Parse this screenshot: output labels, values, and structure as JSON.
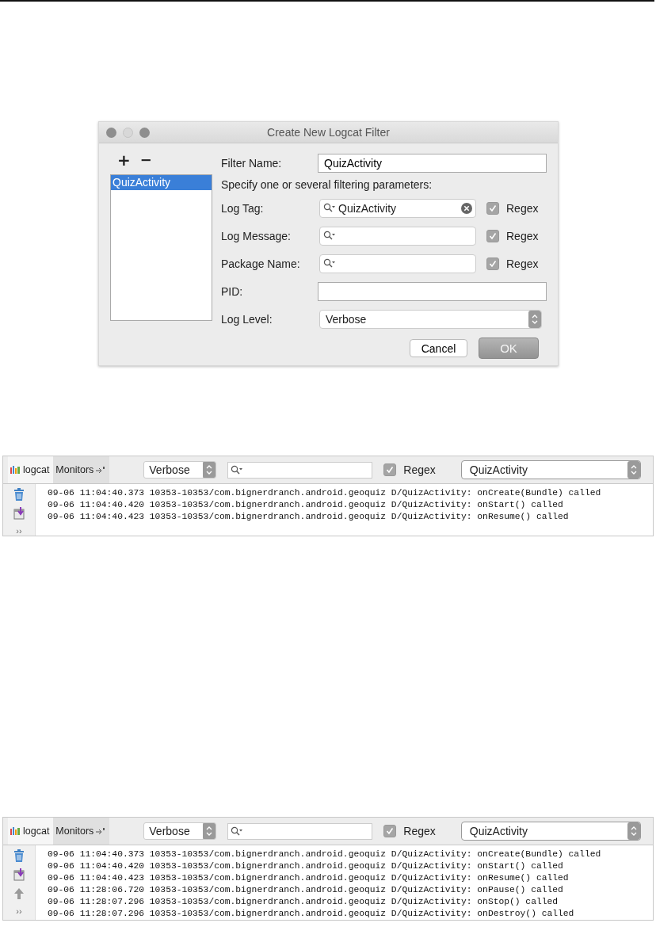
{
  "dialog": {
    "title": "Create New Logcat Filter",
    "list_buttons": [
      {
        "kind": "add",
        "label": "+"
      },
      {
        "kind": "remove",
        "label": "−"
      }
    ],
    "filters": [
      {
        "label": "QuizActivity",
        "selected": true
      }
    ],
    "filter_name": {
      "label": "Filter Name:",
      "value": "QuizActivity"
    },
    "hint": "Specify one or several filtering parameters:",
    "params": [
      {
        "label": "Log Tag:",
        "value": "QuizActivity",
        "regex": {
          "label": "Regex",
          "checked": true
        }
      },
      {
        "label": "Log Message:",
        "regex": {
          "label": "Regex",
          "checked": true
        }
      },
      {
        "label": "Package Name:",
        "regex": {
          "label": "Regex",
          "checked": true
        }
      }
    ],
    "pid": {
      "label": "PID:"
    },
    "log_level": {
      "label": "Log Level:",
      "value": "Verbose"
    },
    "buttons": [
      {
        "label": "Cancel",
        "default": false
      },
      {
        "label": "OK",
        "default": true
      }
    ]
  },
  "logcat_panels": [
    {
      "tabs": [
        {
          "label": "logcat",
          "selected": true
        },
        {
          "label": "Monitors",
          "selected": false
        }
      ],
      "level": "Verbose",
      "regex": {
        "label": "Regex",
        "checked": true
      },
      "filter": "QuizActivity",
      "tools": [
        {
          "kind": "trash"
        },
        {
          "kind": "import"
        }
      ],
      "more": "››",
      "lines": [
        "09-06 11:04:40.373 10353-10353/com.bignerdranch.android.geoquiz D/QuizActivity: onCreate(Bundle) called",
        "09-06 11:04:40.420 10353-10353/com.bignerdranch.android.geoquiz D/QuizActivity: onStart() called",
        "09-06 11:04:40.423 10353-10353/com.bignerdranch.android.geoquiz D/QuizActivity: onResume() called"
      ]
    },
    {
      "tabs": [
        {
          "label": "logcat",
          "selected": true
        },
        {
          "label": "Monitors",
          "selected": false
        }
      ],
      "level": "Verbose",
      "regex": {
        "label": "Regex",
        "checked": true
      },
      "filter": "QuizActivity",
      "tools": [
        {
          "kind": "trash"
        },
        {
          "kind": "import"
        },
        {
          "kind": "up"
        }
      ],
      "more": "››",
      "lines": [
        "09-06 11:04:40.373 10353-10353/com.bignerdranch.android.geoquiz D/QuizActivity: onCreate(Bundle) called",
        "09-06 11:04:40.420 10353-10353/com.bignerdranch.android.geoquiz D/QuizActivity: onStart() called",
        "09-06 11:04:40.423 10353-10353/com.bignerdranch.android.geoquiz D/QuizActivity: onResume() called",
        "09-06 11:28:06.720 10353-10353/com.bignerdranch.android.geoquiz D/QuizActivity: onPause() called",
        "09-06 11:28:07.296 10353-10353/com.bignerdranch.android.geoquiz D/QuizActivity: onStop() called",
        "09-06 11:28:07.296 10353-10353/com.bignerdranch.android.geoquiz D/QuizActivity: onDestroy() called"
      ]
    }
  ]
}
